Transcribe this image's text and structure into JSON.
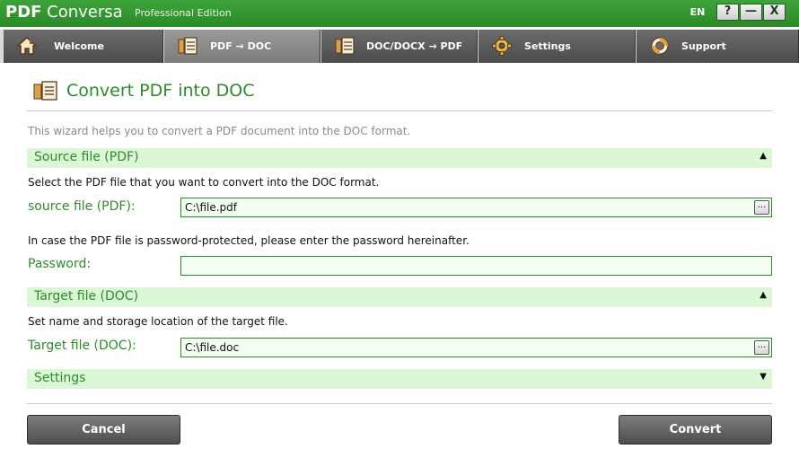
{
  "window": {
    "title_bold": "PDF",
    "title_rest": " Conversa",
    "edition": "Professional Edition",
    "language": "EN",
    "help_label": "?",
    "minimize_label": "—",
    "close_label": "X"
  },
  "tabs": [
    {
      "label": "Welcome",
      "icon": "house-icon",
      "active": false
    },
    {
      "label": "PDF → DOC",
      "icon": "document-icon",
      "active": true
    },
    {
      "label": "DOC/DOCX → PDF",
      "icon": "document-icon",
      "active": false
    },
    {
      "label": "Settings",
      "icon": "gear-icon",
      "active": false
    },
    {
      "label": "Support",
      "icon": "lifebuoy-icon",
      "active": false
    }
  ],
  "page": {
    "title": "Convert PDF into DOC",
    "intro": "This wizard helps you to convert a PDF document into the DOC format."
  },
  "source": {
    "section_label": "Source file (PDF)",
    "description": "Select the PDF file that you want to convert into the DOC format.",
    "field_label": "source file (PDF):",
    "value": "C:\\file.pdf",
    "password_note": "In case the PDF file is password-protected, please enter the password hereinafter.",
    "password_label": "Password:",
    "password_value": ""
  },
  "target": {
    "section_label": "Target file (DOC)",
    "description": "Set name and storage location of the target file.",
    "field_label": "Target file (DOC):",
    "value": "C:\\file.doc"
  },
  "settings": {
    "section_label": "Settings"
  },
  "controls": {
    "collapse_glyph": "▲",
    "expand_glyph": "▼",
    "browse_glyph": "...",
    "cancel_label": "Cancel",
    "convert_label": "Convert"
  },
  "colors": {
    "accent_green": "#2e8b2a",
    "section_bg": "#dbf7d5",
    "titlebar_green": "#3fa33b"
  }
}
